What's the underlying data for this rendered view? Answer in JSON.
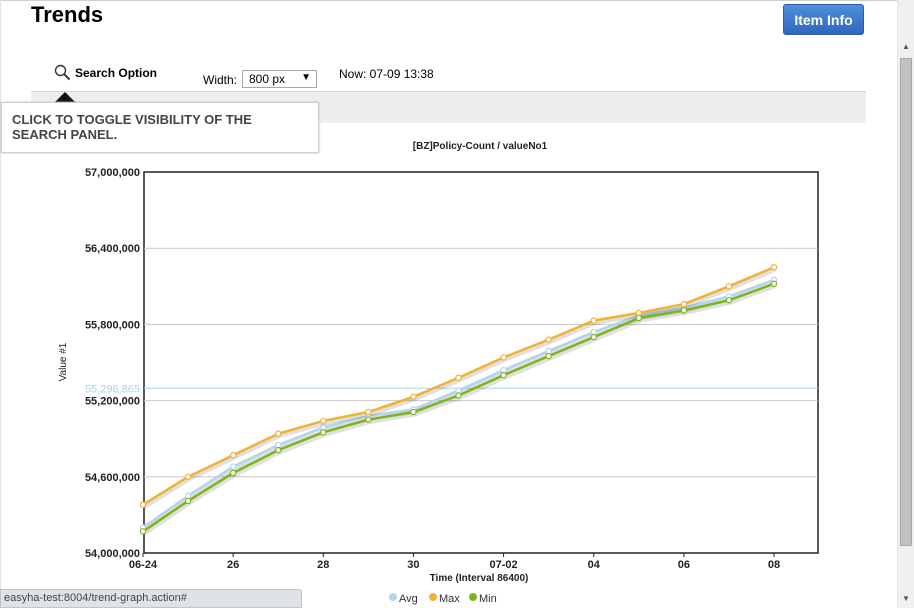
{
  "page": {
    "title": "Trends"
  },
  "toolbar": {
    "item_info_label": "Item Info",
    "search_option_label": "Search Option",
    "width_label": "Width:",
    "width_value": "800 px",
    "now_text": "Now: 07-09 13:38"
  },
  "tooltip": {
    "text": "CLICK TO TOGGLE VISIBILITY OF THE SEARCH PANEL."
  },
  "statusbar": {
    "url": "easyha-test:8004/trend-graph.action#"
  },
  "icons": {
    "search": "magnifier-icon",
    "dropdown": "chevron-down-icon"
  },
  "chart_data": {
    "type": "line",
    "title": "[BZ]Policy-Count / valueNo1",
    "xlabel": "Time (Interval 86400)",
    "ylabel": "Value #1",
    "ylim": [
      54000000,
      57000000
    ],
    "yticks": [
      "57,000,000",
      "56,400,000",
      "55,800,000",
      "55,200,000",
      "54,600,000",
      "54,000,000"
    ],
    "xticks": [
      "06-24",
      "26",
      "28",
      "30",
      "07-02",
      "04",
      "06",
      "08"
    ],
    "x": [
      "06-24",
      "06-25",
      "06-26",
      "06-27",
      "06-28",
      "06-29",
      "06-30",
      "07-01",
      "07-02",
      "07-03",
      "07-04",
      "07-05",
      "07-06",
      "07-07",
      "07-08"
    ],
    "reference_line": {
      "value": 55296865,
      "label": "55,296,865",
      "color": "#a8d4ee"
    },
    "grid": true,
    "legend": "bottom",
    "series": [
      {
        "name": "Avg",
        "color": "#b3d4ee",
        "values": [
          54200000,
          54450000,
          54680000,
          54850000,
          54990000,
          55080000,
          55130000,
          55280000,
          55440000,
          55590000,
          55740000,
          55870000,
          55930000,
          56020000,
          56150000
        ]
      },
      {
        "name": "Max",
        "color": "#f2b230",
        "values": [
          54380000,
          54600000,
          54770000,
          54940000,
          55040000,
          55110000,
          55230000,
          55380000,
          55540000,
          55680000,
          55830000,
          55890000,
          55960000,
          56100000,
          56250000
        ]
      },
      {
        "name": "Min",
        "color": "#7cb518",
        "values": [
          54170000,
          54410000,
          54630000,
          54810000,
          54950000,
          55050000,
          55110000,
          55240000,
          55400000,
          55550000,
          55700000,
          55850000,
          55910000,
          55990000,
          56120000
        ]
      }
    ]
  }
}
